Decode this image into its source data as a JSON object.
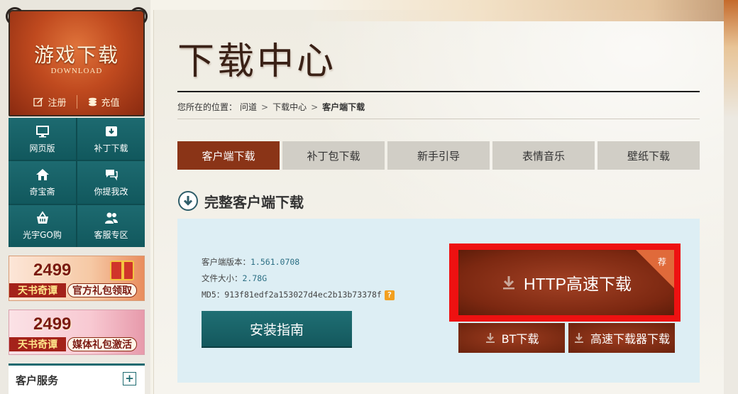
{
  "sidebar": {
    "logo": {
      "title": "游戏下载",
      "subtitle": "DOWNLOAD",
      "register": "注册",
      "recharge": "充值"
    },
    "nav": [
      {
        "label": "网页版",
        "icon": "monitor-icon"
      },
      {
        "label": "补丁下载",
        "icon": "patch-download-icon"
      },
      {
        "label": "奇宝斋",
        "icon": "home-icon"
      },
      {
        "label": "你提我改",
        "icon": "chat-icon"
      },
      {
        "label": "光宇GO购",
        "icon": "basket-icon"
      },
      {
        "label": "客服专区",
        "icon": "users-icon"
      }
    ],
    "promos": [
      {
        "number": "2499",
        "left": "天书奇谭",
        "right": "官方礼包领取"
      },
      {
        "number": "2499",
        "left": "天书奇谭",
        "right": "媒体礼包激活"
      }
    ],
    "customer_service": {
      "title": "客户服务",
      "plus": "+"
    }
  },
  "main": {
    "title": "下载中心",
    "breadcrumb": {
      "prefix": "您所在的位置：",
      "home": "问道",
      "section": "下载中心",
      "current": "客户端下载",
      "sep": ">"
    },
    "tabs": [
      "客户端下载",
      "补丁包下载",
      "新手引导",
      "表情音乐",
      "壁纸下载"
    ],
    "active_tab": 0,
    "section_title": "完整客户端下载",
    "info": {
      "version_label": "客户端版本：",
      "version": "1.561.0708",
      "size_label": "文件大小：",
      "size": "2.78G",
      "md5_label": "MD5：",
      "md5": "913f81edf2a153027d4ec2b13b73378f",
      "help": "?"
    },
    "install_guide": "安装指南",
    "http_download": "HTTP高速下载",
    "recommend_tag": "荐",
    "bt_download": "BT下载",
    "fast_downloader": "高速下载器下载"
  },
  "colors": {
    "teal": "#1d6a70",
    "brown": "#8a3417",
    "highlight": "#ee1111",
    "panel": "#ddeef4"
  }
}
